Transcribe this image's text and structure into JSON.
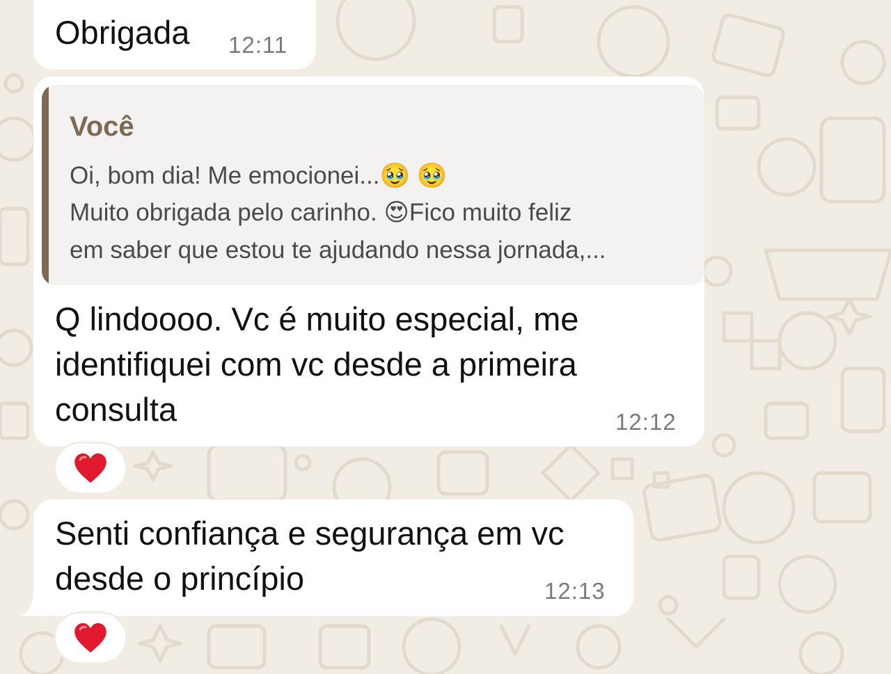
{
  "messages": [
    {
      "text": "Obrigada",
      "time": "12:11"
    },
    {
      "quote": {
        "author": "Você",
        "lines": [
          "Oi, bom dia! Me emocionei...🥹 🥹",
          "Muito obrigada pelo carinho. 😍Fico muito feliz",
          "em saber que estou te ajudando nessa jornada,..."
        ]
      },
      "text_lines": [
        "Q lindoooo. Vc é muito especial, me",
        "identifiquei com vc desde a primeira",
        "consulta"
      ],
      "time": "12:12",
      "reaction": "❤️"
    },
    {
      "text_lines": [
        "Senti confiança e segurança em vc",
        "desde o princípio"
      ],
      "time": "12:13",
      "reaction": "❤️"
    }
  ],
  "colors": {
    "wallpaper": "#f2ede4",
    "bubble": "#ffffff",
    "quote_accent": "#7d6a55",
    "heart": "#e0192e"
  },
  "icons": [
    "heart-icon"
  ]
}
